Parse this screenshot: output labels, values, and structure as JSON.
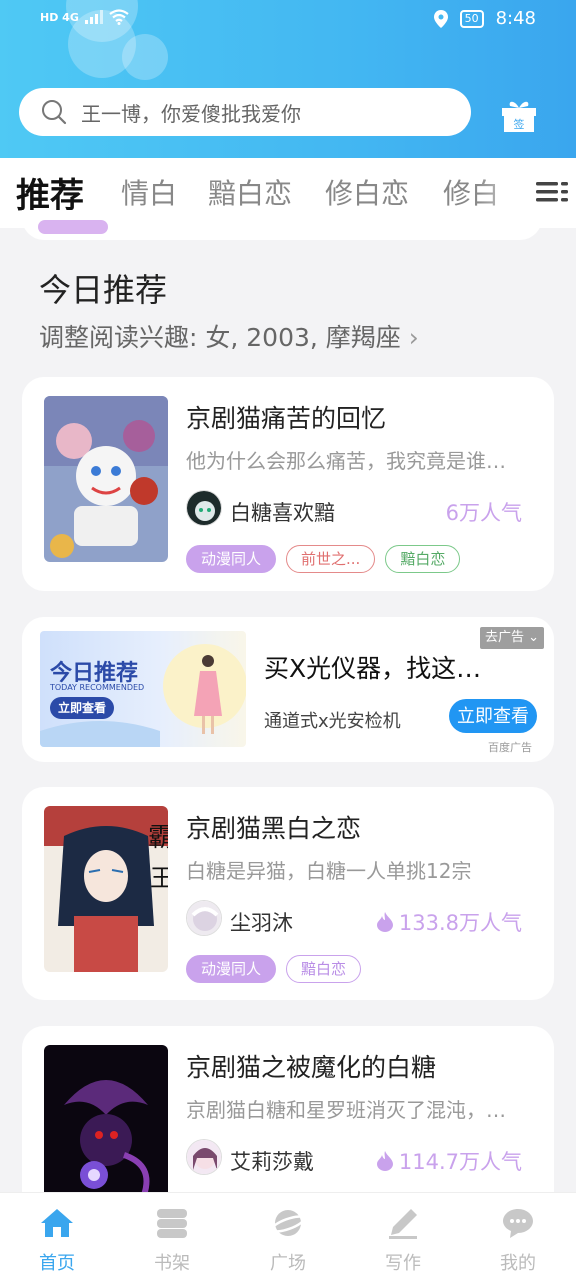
{
  "status_bar": {
    "network": "HD 4G",
    "battery": "50",
    "time": "8:48"
  },
  "search": {
    "placeholder": "王一博，你爱傻批我爱你"
  },
  "gift_label": "签",
  "tabs": [
    "推荐",
    "情白",
    "黯白恋",
    "修白恋",
    "修白"
  ],
  "section": {
    "title": "今日推荐",
    "interest": "调整阅读兴趣: 女, 2003, 摩羯座"
  },
  "books": [
    {
      "title": "京剧猫痛苦的回忆",
      "desc": "他为什么会那么痛苦，我究竟是谁…",
      "author": "白糖喜欢黯",
      "popularity": "6万人气",
      "tags": [
        "动漫同人",
        "前世之...",
        "黯白恋"
      ]
    },
    {
      "title": "京剧猫黑白之恋",
      "desc": "白糖是异猫，白糖一人单挑12宗",
      "author": "尘羽沐",
      "popularity": "133.8万人气",
      "tags": [
        "动漫同人",
        "黯白恋"
      ]
    },
    {
      "title": "京剧猫之被魔化的白糖",
      "desc": "京剧猫白糖和星罗班消灭了混沌，…",
      "author": "艾莉莎戴",
      "popularity": "114.7万人气",
      "tags": []
    }
  ],
  "ad": {
    "image_title": "今日推荐",
    "image_subtitle": "TODAY RECOMMENDED",
    "image_button": "立即查看",
    "title": "买X光仪器，找这…",
    "desc": "通道式x光安检机",
    "button": "立即查看",
    "close": "去广告",
    "source": "百度广告"
  },
  "bottom_nav": [
    "首页",
    "书架",
    "广场",
    "写作",
    "我的"
  ],
  "colors": {
    "accent": "#3aa6ee",
    "tag_purple": "#c9a2ec"
  }
}
